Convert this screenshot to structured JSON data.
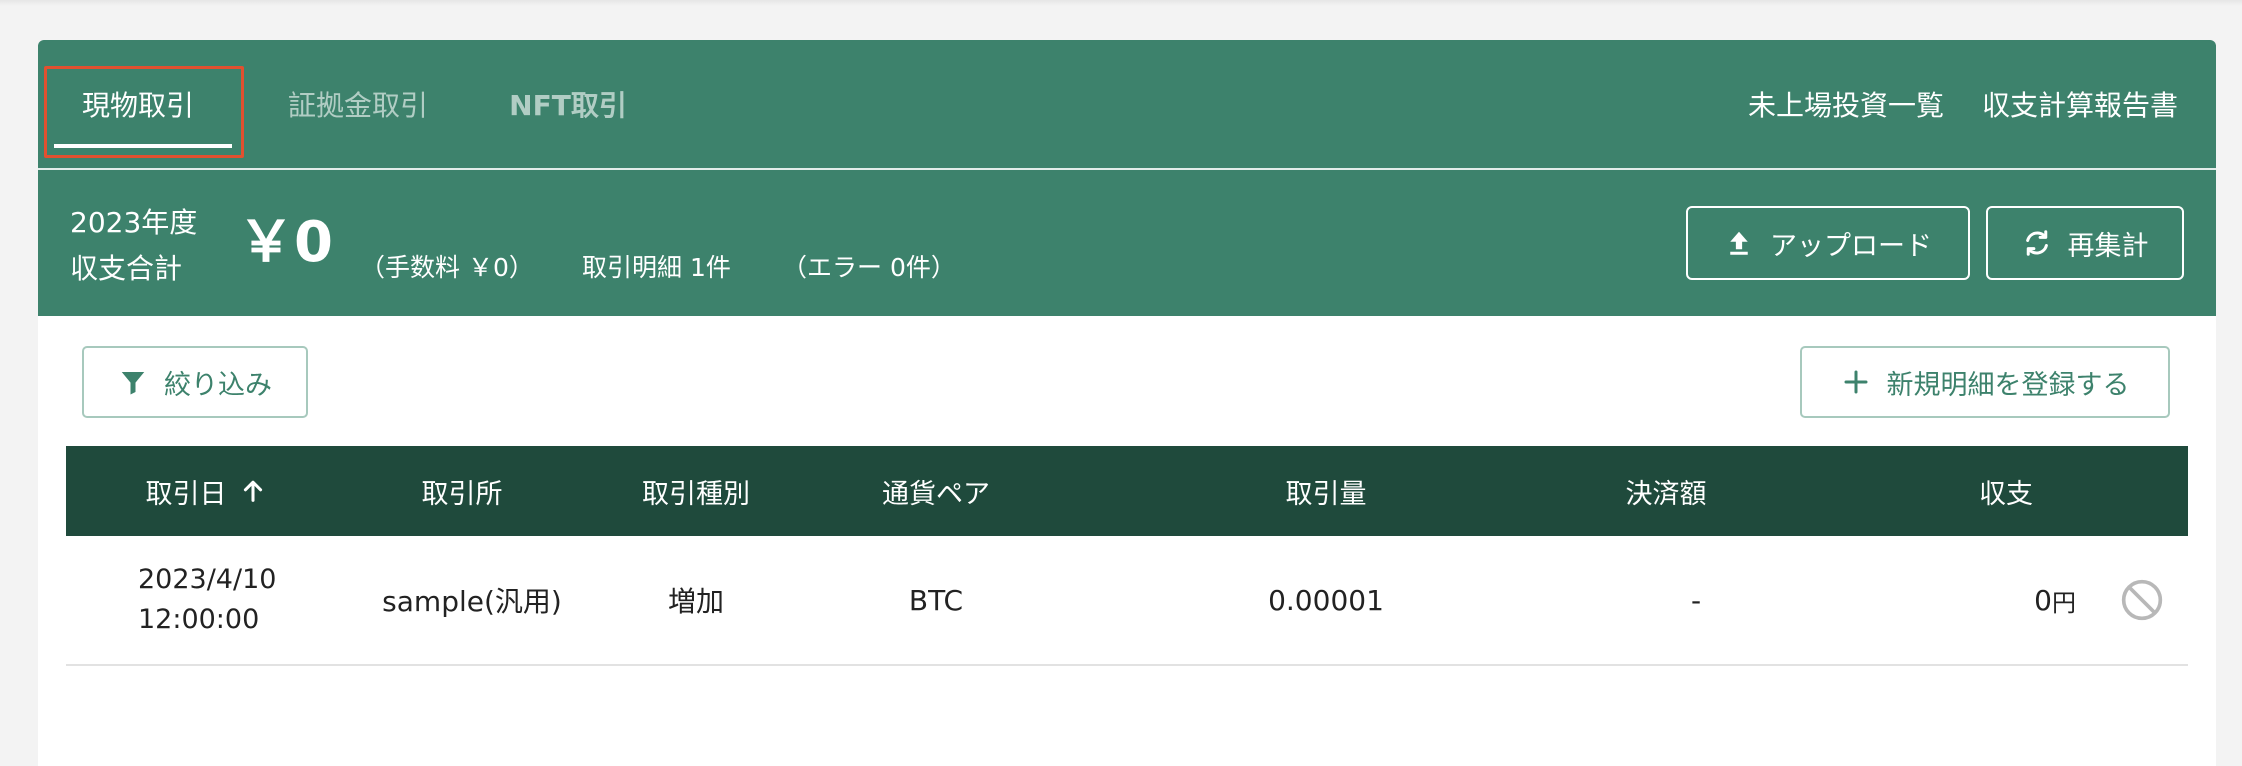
{
  "tabs": [
    {
      "label": "現物取引",
      "active": true
    },
    {
      "label": "証拠金取引",
      "active": false
    },
    {
      "label": "NFT取引",
      "active": false
    }
  ],
  "header_links": [
    "未上場投資一覧",
    "収支計算報告書"
  ],
  "summary": {
    "year": "2023年度",
    "total_label": "収支合計",
    "total_amount": "￥0",
    "fee": "（手数料 ￥0）",
    "transactions": "取引明細 1件",
    "errors": "（エラー 0件）"
  },
  "buttons": {
    "upload": "アップロード",
    "recalculate": "再集計",
    "filter": "絞り込み",
    "new_entry": "新規明細を登録する"
  },
  "table": {
    "headers": [
      "取引日",
      "取引所",
      "取引種別",
      "通貨ペア",
      "取引量",
      "決済額",
      "収支"
    ],
    "rows": [
      {
        "date": "2023/4/10",
        "time": "12:00:00",
        "exchange": "sample(汎用)",
        "type": "増加",
        "pair": "BTC",
        "quantity": "0.00001",
        "settlement": "-",
        "profit": "0",
        "profit_unit": "円"
      }
    ]
  },
  "icons": {
    "sort": "arrow-up-icon",
    "upload": "upload-icon",
    "recalc": "refresh-icon",
    "filter": "funnel-icon",
    "add": "plus-icon",
    "disable": "prohibit-icon"
  },
  "colors": {
    "header_green": "#3d826c",
    "table_header": "#1f4a3c",
    "focus_outline": "#e2502f"
  }
}
